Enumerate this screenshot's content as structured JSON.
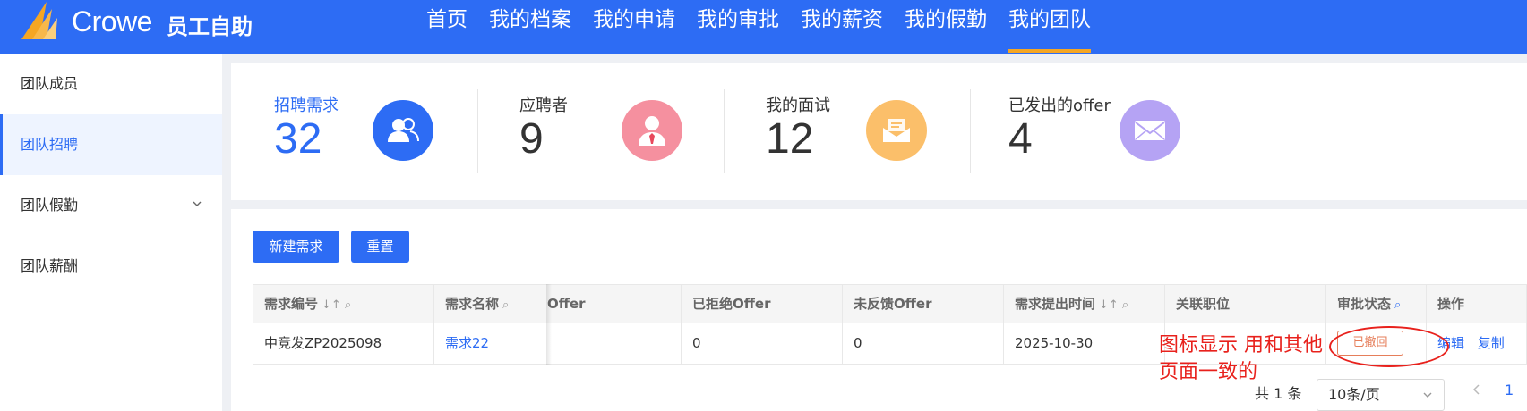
{
  "header": {
    "brand": "Crowe",
    "app_title": "员工自助",
    "nav": [
      "首页",
      "我的档案",
      "我的申请",
      "我的审批",
      "我的薪资",
      "我的假勤",
      "我的团队"
    ],
    "active_nav": "我的团队",
    "accent_color": "#f5a623"
  },
  "sidebar": {
    "items": [
      {
        "label": "团队成员"
      },
      {
        "label": "团队招聘"
      },
      {
        "label": "团队假勤"
      },
      {
        "label": "团队薪酬"
      }
    ],
    "active": "团队招聘"
  },
  "stats": [
    {
      "label": "招聘需求",
      "value": "32",
      "icon": "users-icon",
      "color": "#2d6cf4"
    },
    {
      "label": "应聘者",
      "value": "9",
      "icon": "person-tie-icon",
      "color": "#f5909f"
    },
    {
      "label": "我的面试",
      "value": "12",
      "icon": "mail-open-icon",
      "color": "#fbbf6a"
    },
    {
      "label": "已发出的offer",
      "value": "4",
      "icon": "envelope-icon",
      "color": "#b5a3f4"
    }
  ],
  "toolbar": {
    "new_label": "新建需求",
    "reset_label": "重置"
  },
  "table": {
    "columns": [
      "需求编号",
      "需求名称",
      "Offer",
      "已拒绝Offer",
      "未反馈Offer",
      "需求提出时间",
      "关联职位",
      "审批状态",
      "操作"
    ],
    "rows": [
      {
        "code": "中竞发ZP2025098",
        "name": "需求22",
        "offer": "",
        "rejected": "0",
        "no_feedback": "0",
        "date": "2025-10-30",
        "position": "",
        "status": "已撤回",
        "actions": [
          "编辑",
          "复制"
        ]
      }
    ]
  },
  "annotation": "图标显示 用和其他页面一致的",
  "pagination": {
    "total": "共 1 条",
    "page_size": "10条/页",
    "current_page": "1"
  }
}
